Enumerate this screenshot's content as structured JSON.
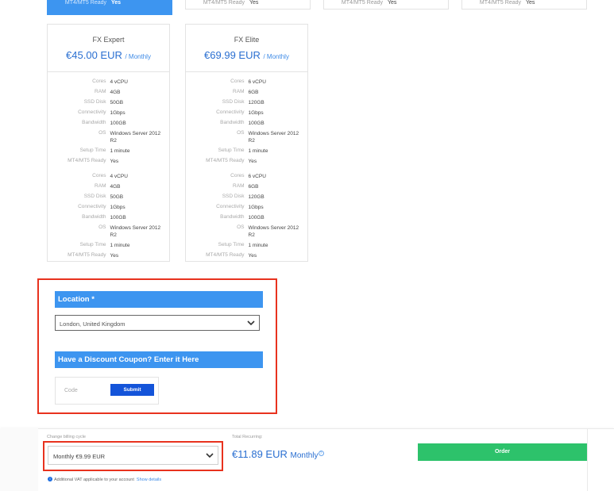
{
  "top_row": [
    {
      "key": "MT4/MT5 Ready",
      "value": "Yes",
      "active": true
    },
    {
      "key": "MT4/MT5 Ready",
      "value": "Yes",
      "active": false
    },
    {
      "key": "MT4/MT5 Ready",
      "value": "Yes",
      "active": false
    },
    {
      "key": "MT4/MT5 Ready",
      "value": "Yes",
      "active": false
    }
  ],
  "plans": [
    {
      "name": "FX Expert",
      "price": "€45.00 EUR",
      "period": "/ Monthly",
      "specs": [
        {
          "key": "Cores",
          "value": "4 vCPU"
        },
        {
          "key": "RAM",
          "value": "4GB"
        },
        {
          "key": "SSD Disk",
          "value": "50GB"
        },
        {
          "key": "Connectivity",
          "value": "1Gbps"
        },
        {
          "key": "Bandwidth",
          "value": "100GB"
        },
        {
          "key": "OS",
          "value": "Windows Server 2012 R2"
        },
        {
          "key": "Setup Time",
          "value": "1 minute"
        },
        {
          "key": "MT4/MT5 Ready",
          "value": "Yes"
        }
      ]
    },
    {
      "name": "FX Elite",
      "price": "€69.99 EUR",
      "period": "/ Monthly",
      "specs": [
        {
          "key": "Cores",
          "value": "6 vCPU"
        },
        {
          "key": "RAM",
          "value": "6GB"
        },
        {
          "key": "SSD Disk",
          "value": "120GB"
        },
        {
          "key": "Connectivity",
          "value": "1Gbps"
        },
        {
          "key": "Bandwidth",
          "value": "100GB"
        },
        {
          "key": "OS",
          "value": "Windows Server 2012 R2"
        },
        {
          "key": "Setup Time",
          "value": "1 minute"
        },
        {
          "key": "MT4/MT5 Ready",
          "value": "Yes"
        }
      ]
    }
  ],
  "location": {
    "heading": "Location *",
    "selected": "London, United Kingdom"
  },
  "coupon": {
    "heading": "Have a Discount Coupon? Enter it Here",
    "placeholder": "Code",
    "submit_label": "Submit"
  },
  "billing": {
    "cycle_label": "Change billing cycle",
    "cycle_selected": "Monthly €9.99 EUR",
    "vat_note": "Additional VAT applicable to your account",
    "vat_link": "Show details",
    "total_label": "Total Recurring:",
    "total_amount": "€11.89 EUR",
    "total_period": "Monthly",
    "order_label": "Order"
  },
  "colors": {
    "accent": "#3d95f0",
    "price": "#2a6fd1",
    "highlight": "#e8321e",
    "order": "#2dc26b",
    "submit": "#1454d9"
  }
}
